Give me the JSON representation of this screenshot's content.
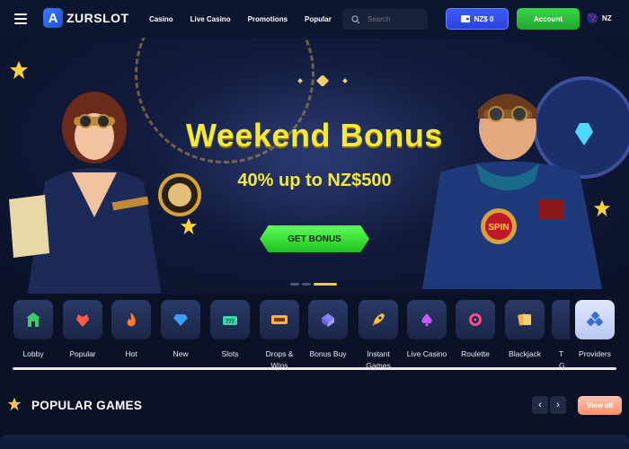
{
  "brand": {
    "logo_letter": "A",
    "name": "ZURSLOT"
  },
  "nav": [
    {
      "label": "Casino"
    },
    {
      "label": "Live Casino"
    },
    {
      "label": "Promotions"
    },
    {
      "label": "Popular"
    }
  ],
  "search": {
    "placeholder": "Search"
  },
  "wallet": {
    "balance": "NZ$ 0"
  },
  "account": {
    "label": "Account"
  },
  "locale": {
    "code": "NZ"
  },
  "banner": {
    "title": "Weekend Bonus",
    "subtitle": "40% up to NZ$500",
    "cta": "GET BONUS",
    "badge_spin": "SPIN",
    "slides_total": 3,
    "active_slide": 3
  },
  "categories": [
    {
      "label": "Lobby",
      "icon": "lobby-icon",
      "color": "#3ec86b"
    },
    {
      "label": "Popular",
      "icon": "popular-icon",
      "color": "#ff5a4a"
    },
    {
      "label": "Hot",
      "icon": "flame-icon",
      "color": "#ff7a2e"
    },
    {
      "label": "New",
      "icon": "diamond-icon",
      "color": "#3a9cff"
    },
    {
      "label": "Slots",
      "icon": "slots-icon",
      "color": "#39d6b2"
    },
    {
      "label": "Drops & Wins",
      "icon": "drops-wins-icon",
      "color": "#ffb04a"
    },
    {
      "label": "Bonus Buy",
      "icon": "bonus-buy-icon",
      "color": "#8a7dff"
    },
    {
      "label": "Instant Games",
      "icon": "rocket-icon",
      "color": "#ffc33a"
    },
    {
      "label": "Live Casino",
      "icon": "spade-icon",
      "color": "#c65cff"
    },
    {
      "label": "Roulette",
      "icon": "roulette-icon",
      "color": "#ff4b8a"
    },
    {
      "label": "Blackjack",
      "icon": "cards-icon",
      "color": "#ffae3a"
    },
    {
      "label": "T G",
      "icon": "partial-icon",
      "color": "#8a7dff"
    },
    {
      "label": "Providers",
      "icon": "providers-icon",
      "color": "#3a6bd8"
    }
  ],
  "popular": {
    "title": "POPULAR GAMES",
    "view_all": "View all"
  }
}
